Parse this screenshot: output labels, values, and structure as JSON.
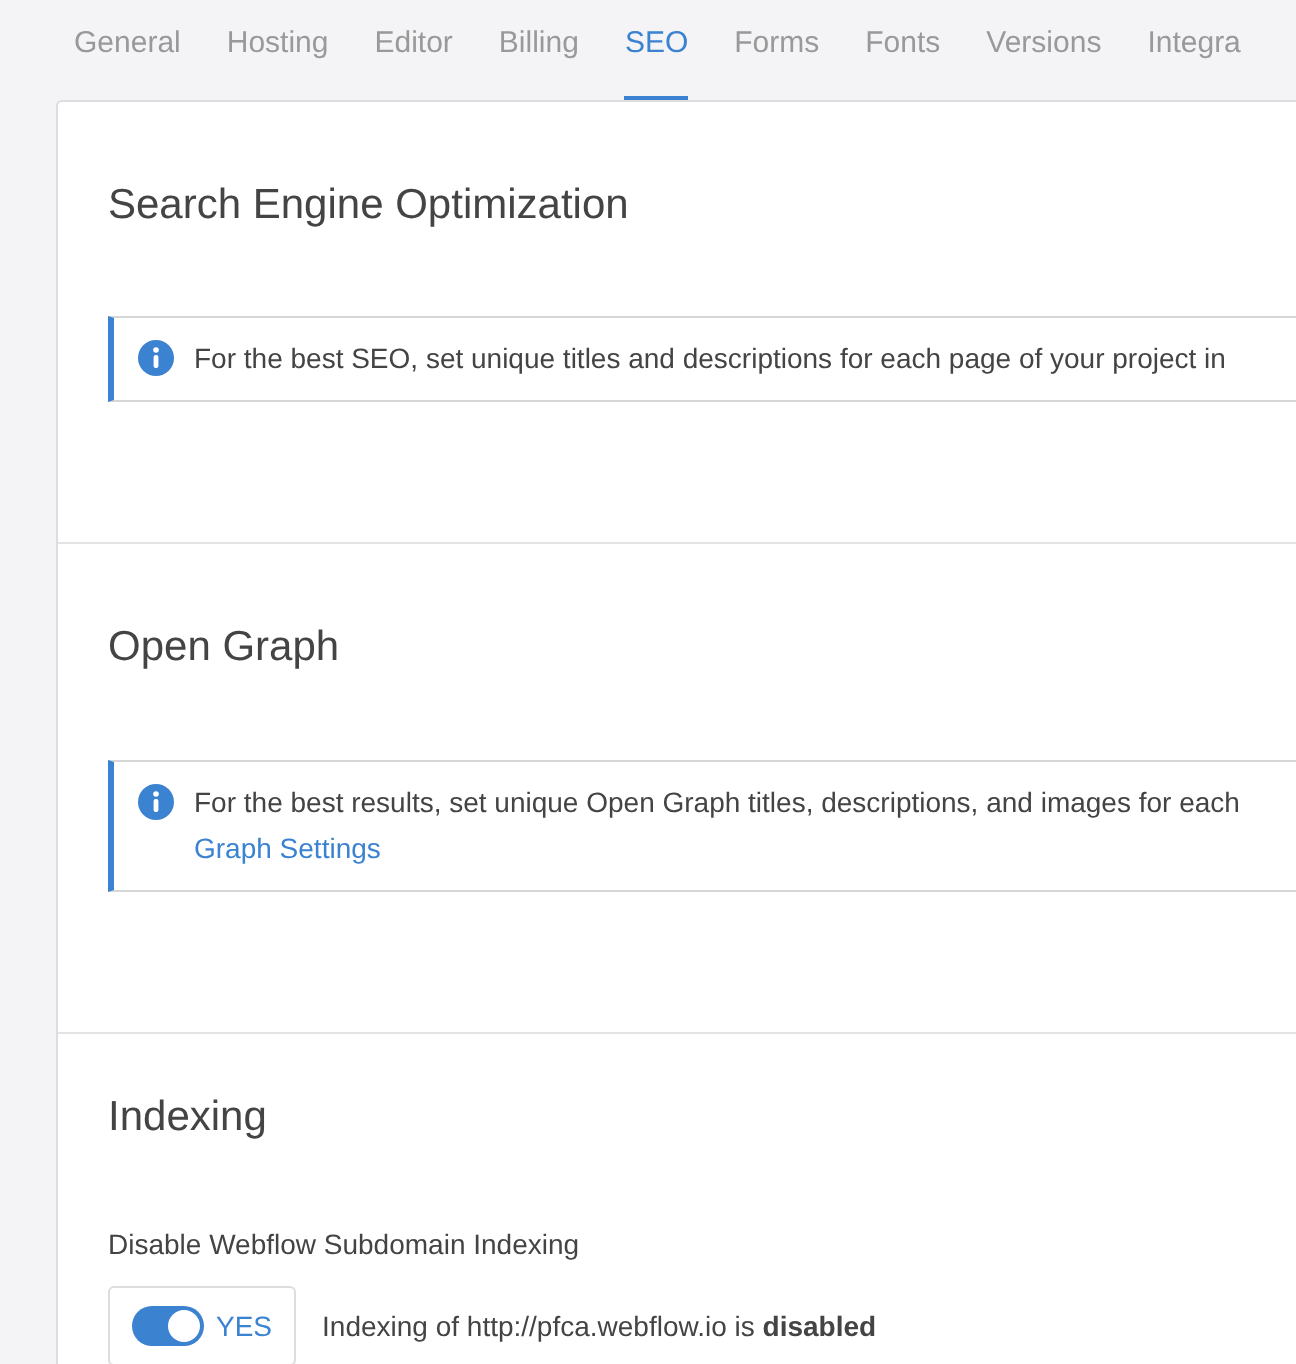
{
  "tabs": [
    {
      "label": "General",
      "selected": false
    },
    {
      "label": "Hosting",
      "selected": false
    },
    {
      "label": "Editor",
      "selected": false
    },
    {
      "label": "Billing",
      "selected": false
    },
    {
      "label": "SEO",
      "selected": true
    },
    {
      "label": "Forms",
      "selected": false
    },
    {
      "label": "Fonts",
      "selected": false
    },
    {
      "label": "Versions",
      "selected": false
    },
    {
      "label": "Integra",
      "selected": false
    }
  ],
  "sections": [
    {
      "title": "Search Engine Optimization",
      "callout": {
        "text": "For the best SEO, set unique titles and descriptions for each page of your project in"
      }
    },
    {
      "title": "Open Graph",
      "callout": {
        "text": "For the best results, set unique Open Graph titles, descriptions, and images for each",
        "link": "Graph Settings"
      }
    },
    {
      "title": "Indexing",
      "setting": {
        "label": "Disable Webflow Subdomain Indexing",
        "toggle": {
          "on": true,
          "label": "YES"
        },
        "status": "Indexing of http://pfca.webflow.io is **disabled**"
      }
    }
  ]
}
